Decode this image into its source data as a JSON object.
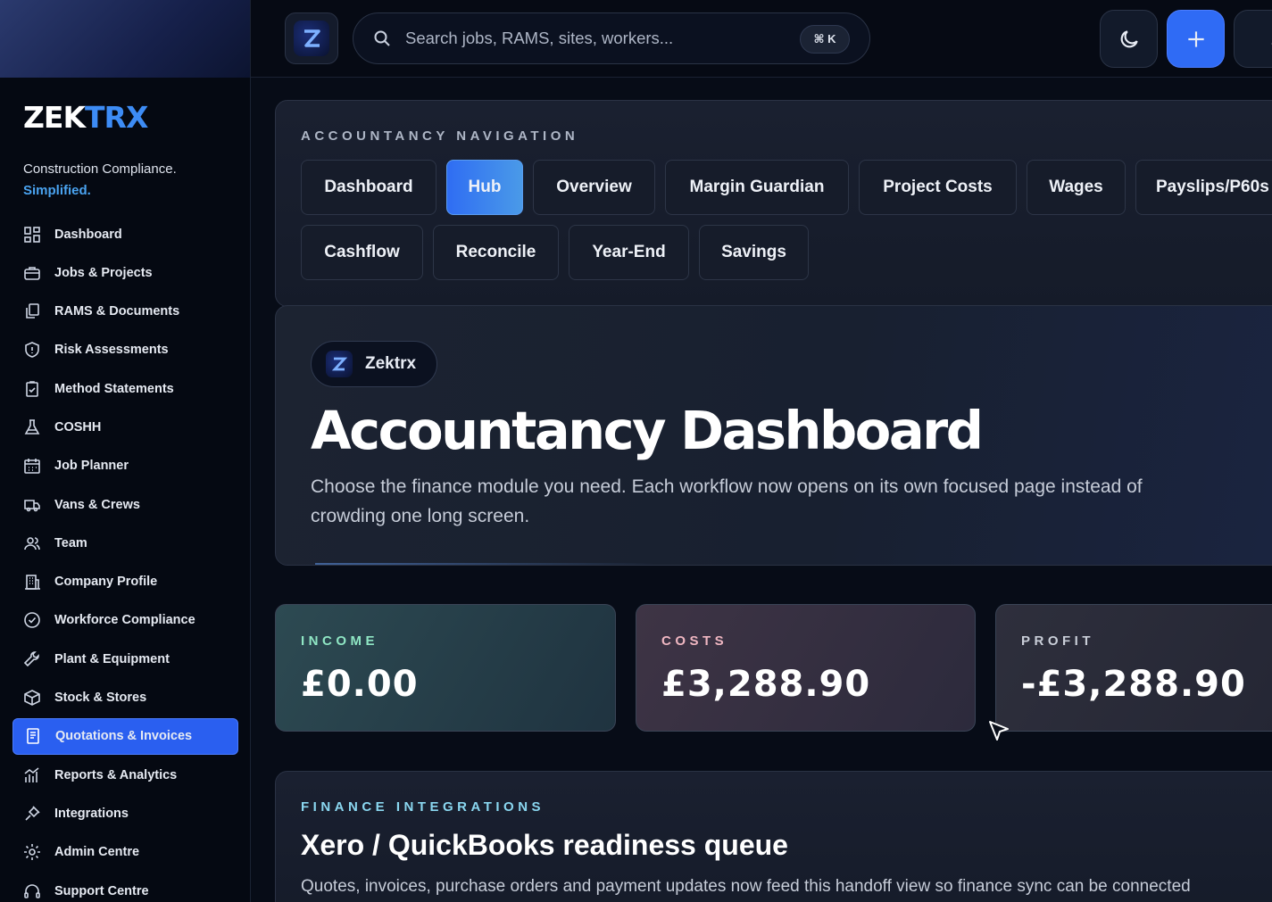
{
  "sidebar": {
    "brand_a": "ZEK",
    "brand_b": "TRX",
    "tagline": "Construction Compliance.",
    "tagline_highlight": "Simplified.",
    "items": [
      {
        "label": "Dashboard",
        "icon": "grid-icon"
      },
      {
        "label": "Jobs & Projects",
        "icon": "briefcase-icon"
      },
      {
        "label": "RAMS & Documents",
        "icon": "documents-icon"
      },
      {
        "label": "Risk Assessments",
        "icon": "shield-icon"
      },
      {
        "label": "Method Statements",
        "icon": "clipboard-check-icon"
      },
      {
        "label": "COSHH",
        "icon": "flask-icon"
      },
      {
        "label": "Job Planner",
        "icon": "calendar-icon"
      },
      {
        "label": "Vans & Crews",
        "icon": "van-icon"
      },
      {
        "label": "Team",
        "icon": "users-icon"
      },
      {
        "label": "Company Profile",
        "icon": "building-icon"
      },
      {
        "label": "Workforce Compliance",
        "icon": "check-circle-icon"
      },
      {
        "label": "Plant & Equipment",
        "icon": "wrench-icon"
      },
      {
        "label": "Stock & Stores",
        "icon": "box-icon"
      },
      {
        "label": "Quotations & Invoices",
        "icon": "invoice-icon",
        "active": true
      },
      {
        "label": "Reports & Analytics",
        "icon": "chart-icon"
      },
      {
        "label": "Integrations",
        "icon": "plug-icon"
      },
      {
        "label": "Admin Centre",
        "icon": "gear-icon"
      },
      {
        "label": "Support Centre",
        "icon": "headset-icon"
      }
    ]
  },
  "topbar": {
    "search_placeholder": "Search jobs, RAMS, sites, workers...",
    "shortcut": "⌘ K"
  },
  "nav_panel": {
    "eyebrow": "ACCOUNTANCY NAVIGATION",
    "tabs": [
      "Dashboard",
      "Hub",
      "Overview",
      "Margin Guardian",
      "Project Costs",
      "Wages",
      "Payslips/P60s",
      "Cashflow",
      "Reconcile",
      "Year-End",
      "Savings"
    ],
    "active_tab": "Hub"
  },
  "hero": {
    "chip": "Zektrx",
    "title": "Accountancy Dashboard",
    "description": "Choose the finance module you need. Each workflow now opens on its own focused page instead of crowding one long screen."
  },
  "stats": [
    {
      "label": "INCOME",
      "value": "£0.00",
      "color": "#8fe6c4"
    },
    {
      "label": "COSTS",
      "value": "£3,288.90",
      "color": "#f0b7c2"
    },
    {
      "label": "PROFIT",
      "value": "-£3,288.90",
      "color": "#c9ced8"
    }
  ],
  "finance": {
    "eyebrow": "FINANCE INTEGRATIONS",
    "title": "Xero / QuickBooks readiness queue",
    "description": "Quotes, invoices, purchase orders and payment updates now feed this handoff view so finance sync can be connected"
  },
  "colors": {
    "accent": "#2f6bf5",
    "brand_blue": "#3d8cf5",
    "background": "#070c17"
  }
}
